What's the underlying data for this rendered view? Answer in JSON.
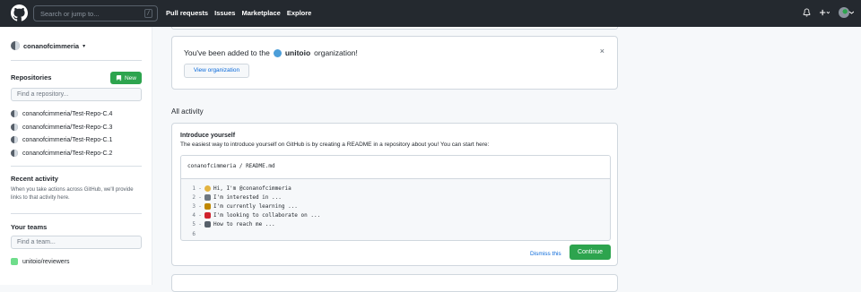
{
  "header": {
    "search_placeholder": "Search or jump to...",
    "search_shortcut": "/",
    "nav": [
      "Pull requests",
      "Issues",
      "Marketplace",
      "Explore"
    ]
  },
  "sidebar": {
    "user": "conanofcimmeria",
    "repositories_heading": "Repositories",
    "new_label": "New",
    "find_repo_placeholder": "Find a repository...",
    "repos": [
      "conanofcimmeria/Test-Repo-C.4",
      "conanofcimmeria/Test-Repo-C.3",
      "conanofcimmeria/Test-Repo-C.1",
      "conanofcimmeria/Test-Repo-C.2"
    ],
    "recent_heading": "Recent activity",
    "recent_text": "When you take actions across GitHub, we'll provide links to that activity here.",
    "teams_heading": "Your teams",
    "find_team_placeholder": "Find a team...",
    "teams": [
      "unitoio/reviewers"
    ]
  },
  "org_notice": {
    "prefix": "You've been added to the",
    "org": "unitoio",
    "suffix": "organization!",
    "button": "View organization",
    "close": "×"
  },
  "activity": {
    "heading": "All activity",
    "intro_title": "Introduce yourself",
    "intro_sub": "The easiest way to introduce yourself on GitHub is by creating a README in a repository about you! You can start here:",
    "path_user": "conanofcimmeria",
    "path_sep": "/",
    "path_file": "README.md",
    "lines": [
      {
        "n": "1",
        "text": "Hi, I'm @conanofcimmeria",
        "emoji_color": "#e3b341"
      },
      {
        "n": "2",
        "text": "I'm interested in ...",
        "emoji_color": "#6e7781"
      },
      {
        "n": "3",
        "text": "I'm currently learning ...",
        "emoji_color": "#bf8700"
      },
      {
        "n": "4",
        "text": "I'm looking to collaborate on ...",
        "emoji_color": "#cf222e"
      },
      {
        "n": "5",
        "text": "How to reach me ...",
        "emoji_color": "#57606a"
      },
      {
        "n": "6",
        "text": "",
        "emoji_color": ""
      }
    ],
    "dismiss": "Dismiss this",
    "continue": "Continue"
  }
}
